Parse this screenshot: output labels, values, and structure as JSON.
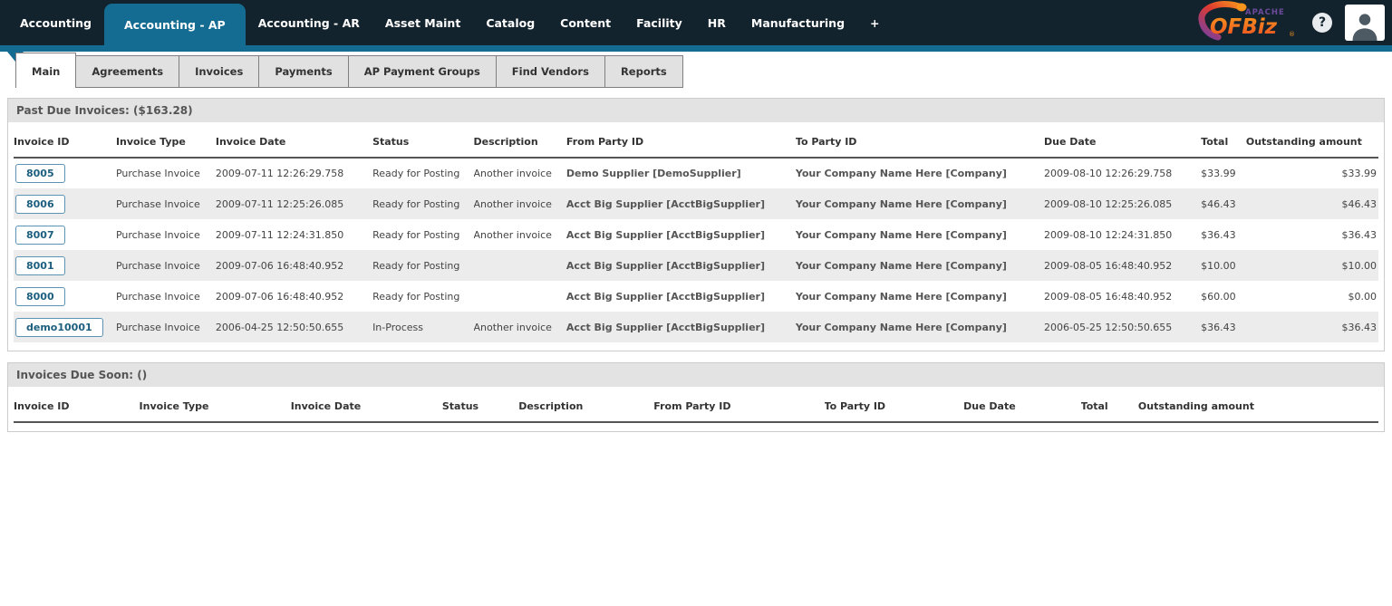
{
  "app_nav": {
    "items": [
      {
        "label": "Accounting",
        "active": false
      },
      {
        "label": "Accounting - AP",
        "active": true
      },
      {
        "label": "Accounting - AR",
        "active": false
      },
      {
        "label": "Asset Maint",
        "active": false
      },
      {
        "label": "Catalog",
        "active": false
      },
      {
        "label": "Content",
        "active": false
      },
      {
        "label": "Facility",
        "active": false
      },
      {
        "label": "HR",
        "active": false
      },
      {
        "label": "Manufacturing",
        "active": false
      },
      {
        "label": "+",
        "active": false
      }
    ],
    "logo": {
      "apache": "APACHE",
      "name": "OFBiz",
      "mark": "®"
    },
    "help_label": "?"
  },
  "sub_nav": {
    "tabs": [
      {
        "label": "Main",
        "active": true
      },
      {
        "label": "Agreements",
        "active": false
      },
      {
        "label": "Invoices",
        "active": false
      },
      {
        "label": "Payments",
        "active": false
      },
      {
        "label": "AP Payment Groups",
        "active": false
      },
      {
        "label": "Find Vendors",
        "active": false
      },
      {
        "label": "Reports",
        "active": false
      }
    ]
  },
  "past_due": {
    "title": "Past Due Invoices: ($163.28)",
    "columns": [
      "Invoice ID",
      "Invoice Type",
      "Invoice Date",
      "Status",
      "Description",
      "From Party ID",
      "To Party ID",
      "Due Date",
      "Total",
      "Outstanding amount"
    ],
    "rows": [
      {
        "id": "8005",
        "type": "Purchase Invoice",
        "date": "2009-07-11 12:26:29.758",
        "status": "Ready for Posting",
        "description": "Another invoice",
        "from": "Demo Supplier [DemoSupplier]",
        "to": "Your Company Name Here [Company]",
        "due": "2009-08-10 12:26:29.758",
        "total": "$33.99",
        "outstanding": "$33.99"
      },
      {
        "id": "8006",
        "type": "Purchase Invoice",
        "date": "2009-07-11 12:25:26.085",
        "status": "Ready for Posting",
        "description": "Another invoice",
        "from": "Acct Big Supplier [AcctBigSupplier]",
        "to": "Your Company Name Here [Company]",
        "due": "2009-08-10 12:25:26.085",
        "total": "$46.43",
        "outstanding": "$46.43"
      },
      {
        "id": "8007",
        "type": "Purchase Invoice",
        "date": "2009-07-11 12:24:31.850",
        "status": "Ready for Posting",
        "description": "Another invoice",
        "from": "Acct Big Supplier [AcctBigSupplier]",
        "to": "Your Company Name Here [Company]",
        "due": "2009-08-10 12:24:31.850",
        "total": "$36.43",
        "outstanding": "$36.43"
      },
      {
        "id": "8001",
        "type": "Purchase Invoice",
        "date": "2009-07-06 16:48:40.952",
        "status": "Ready for Posting",
        "description": "",
        "from": "Acct Big Supplier [AcctBigSupplier]",
        "to": "Your Company Name Here [Company]",
        "due": "2009-08-05 16:48:40.952",
        "total": "$10.00",
        "outstanding": "$10.00"
      },
      {
        "id": "8000",
        "type": "Purchase Invoice",
        "date": "2009-07-06 16:48:40.952",
        "status": "Ready for Posting",
        "description": "",
        "from": "Acct Big Supplier [AcctBigSupplier]",
        "to": "Your Company Name Here [Company]",
        "due": "2009-08-05 16:48:40.952",
        "total": "$60.00",
        "outstanding": "$0.00"
      },
      {
        "id": "demo10001",
        "type": "Purchase Invoice",
        "date": "2006-04-25 12:50:50.655",
        "status": "In-Process",
        "description": "Another invoice",
        "from": "Acct Big Supplier [AcctBigSupplier]",
        "to": "Your Company Name Here [Company]",
        "due": "2006-05-25 12:50:50.655",
        "total": "$36.43",
        "outstanding": "$36.43"
      }
    ]
  },
  "due_soon": {
    "title": "Invoices Due Soon: ()",
    "columns": [
      "Invoice ID",
      "Invoice Type",
      "Invoice Date",
      "Status",
      "Description",
      "From Party ID",
      "To Party ID",
      "Due Date",
      "Total",
      "Outstanding amount"
    ],
    "rows": []
  },
  "colors": {
    "topbar_bg": "#13232e",
    "accent_blue": "#156c92",
    "invoice_link": "#1c5e7e",
    "logo_orange": "#f7941d",
    "logo_purple": "#7f3f98"
  }
}
